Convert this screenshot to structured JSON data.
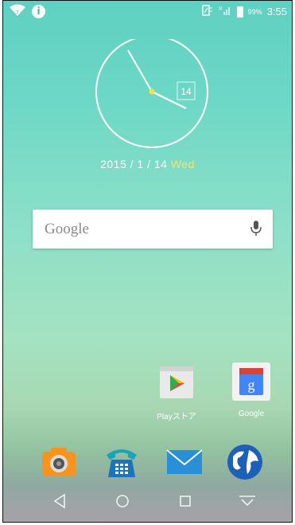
{
  "status_bar": {
    "time": "3:55",
    "battery_percent": "99%",
    "icons": [
      "wifi-icon",
      "info-icon",
      "sim-icon",
      "no-signal-icon",
      "battery-icon"
    ]
  },
  "clock_widget": {
    "day_number": "14",
    "date_text": "2015 / 1 / 14",
    "weekday": "Wed",
    "time_shown": "3:55"
  },
  "search_bar": {
    "label": "Google",
    "icon": "mic-icon"
  },
  "home_apps": [
    {
      "label": "Playストア",
      "icon": "play-store-icon"
    },
    {
      "label": "Google",
      "icon": "google-folder-icon"
    }
  ],
  "dock": [
    {
      "icon": "camera-icon"
    },
    {
      "icon": "phone-icon"
    },
    {
      "icon": "mail-icon"
    },
    {
      "icon": "browser-globe-icon"
    }
  ],
  "nav_bar": [
    "back-icon",
    "home-icon",
    "recents-icon",
    "notification-pull-icon"
  ],
  "colors": {
    "accent_date": "#f4e46a",
    "clock_center": "#f2e24a",
    "wallpaper_top": "#5fd0c2",
    "wallpaper_bottom": "#a7a1a8"
  }
}
